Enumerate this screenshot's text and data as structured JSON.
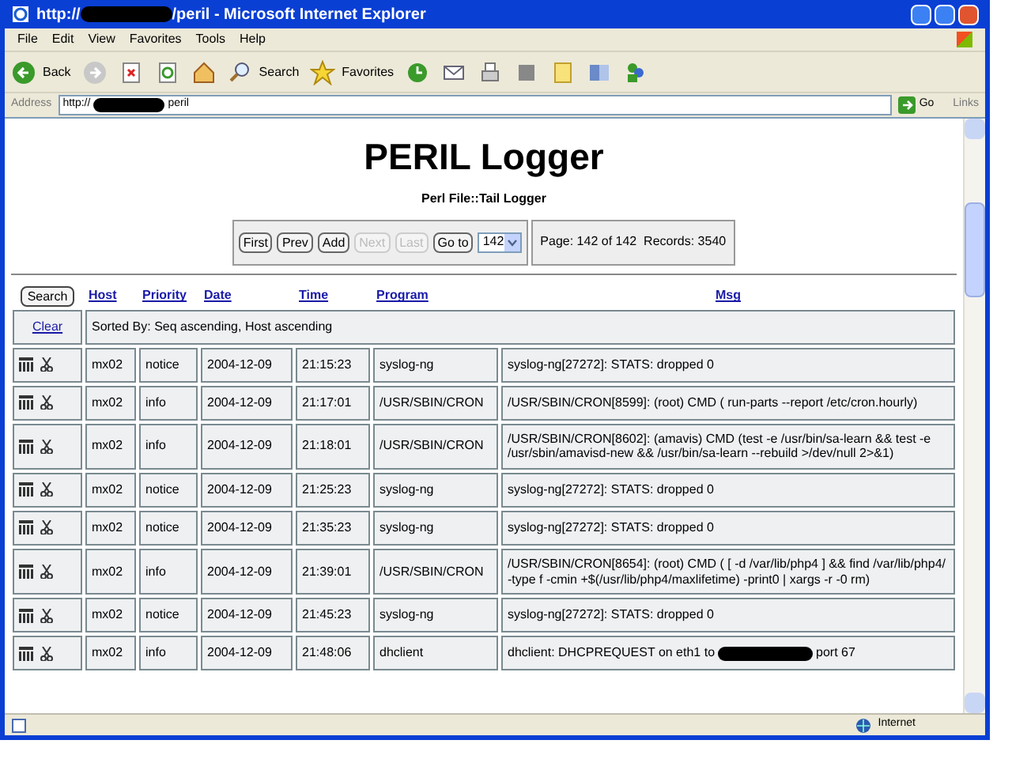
{
  "window": {
    "title_prefix": "http://",
    "title_suffix": "/peril - Microsoft Internet Explorer"
  },
  "menu": [
    "File",
    "Edit",
    "View",
    "Favorites",
    "Tools",
    "Help"
  ],
  "toolbar": [
    {
      "kind": "back",
      "label": "Back"
    },
    {
      "kind": "forward"
    },
    {
      "kind": "stop"
    },
    {
      "kind": "refresh"
    },
    {
      "kind": "home"
    },
    {
      "kind": "search",
      "label": "Search"
    },
    {
      "kind": "favorites",
      "label": "Favorites"
    },
    {
      "kind": "history"
    },
    {
      "kind": "mail"
    },
    {
      "kind": "print"
    },
    {
      "kind": "edit"
    },
    {
      "kind": "note"
    },
    {
      "kind": "research"
    },
    {
      "kind": "messenger"
    }
  ],
  "address": {
    "label": "Address",
    "prefix": "http://",
    "suffix": "peril",
    "go": "Go",
    "links": "Links"
  },
  "page": {
    "title": "PERIL Logger",
    "subtitle": "Perl File::Tail Logger",
    "nav": [
      {
        "label": "First",
        "disabled": false
      },
      {
        "label": "Prev",
        "disabled": false
      },
      {
        "label": "Add",
        "disabled": false
      },
      {
        "label": "Next",
        "disabled": true
      },
      {
        "label": "Last",
        "disabled": true
      },
      {
        "label": "Go to",
        "disabled": false
      }
    ],
    "goto_value": "142",
    "page_info": "Page: 142 of 142  Records: 3540",
    "search_button": "Search",
    "columns": [
      "Host",
      "Priority",
      "Date",
      "Time",
      "Program",
      "Msg"
    ],
    "clear": "Clear",
    "sorted_by": "Sorted By: Seq ascending, Host ascending",
    "rows": [
      {
        "host": "mx02",
        "priority": "notice",
        "date": "2004-12-09",
        "time": "21:15:23",
        "program": "syslog-ng",
        "msg": "syslog-ng[27272]: STATS: dropped 0"
      },
      {
        "host": "mx02",
        "priority": "info",
        "date": "2004-12-09",
        "time": "21:17:01",
        "program": "/USR/SBIN/CRON",
        "msg": "/USR/SBIN/CRON[8599]: (root) CMD ( run-parts --report /etc/cron.hourly)"
      },
      {
        "host": "mx02",
        "priority": "info",
        "date": "2004-12-09",
        "time": "21:18:01",
        "program": "/USR/SBIN/CRON",
        "msg": "/USR/SBIN/CRON[8602]: (amavis) CMD (test -e /usr/bin/sa-learn && test -e /usr/sbin/amavisd-new && /usr/bin/sa-learn --rebuild >/dev/null 2>&1)"
      },
      {
        "host": "mx02",
        "priority": "notice",
        "date": "2004-12-09",
        "time": "21:25:23",
        "program": "syslog-ng",
        "msg": "syslog-ng[27272]: STATS: dropped 0"
      },
      {
        "host": "mx02",
        "priority": "notice",
        "date": "2004-12-09",
        "time": "21:35:23",
        "program": "syslog-ng",
        "msg": "syslog-ng[27272]: STATS: dropped 0"
      },
      {
        "host": "mx02",
        "priority": "info",
        "date": "2004-12-09",
        "time": "21:39:01",
        "program": "/USR/SBIN/CRON",
        "msg": "/USR/SBIN/CRON[8654]: (root) CMD ( [ -d /var/lib/php4 ] && find /var/lib/php4/ -type f -cmin +$(/usr/lib/php4/maxlifetime) -print0 | xargs -r -0 rm)"
      },
      {
        "host": "mx02",
        "priority": "notice",
        "date": "2004-12-09",
        "time": "21:45:23",
        "program": "syslog-ng",
        "msg": "syslog-ng[27272]: STATS: dropped 0"
      },
      {
        "host": "mx02",
        "priority": "info",
        "date": "2004-12-09",
        "time": "21:48:06",
        "program": "dhclient",
        "msg": "dhclient: DHCPREQUEST on eth1 to",
        "msg_end": "port 67"
      }
    ]
  },
  "status_bar": {
    "zone": "Internet"
  }
}
